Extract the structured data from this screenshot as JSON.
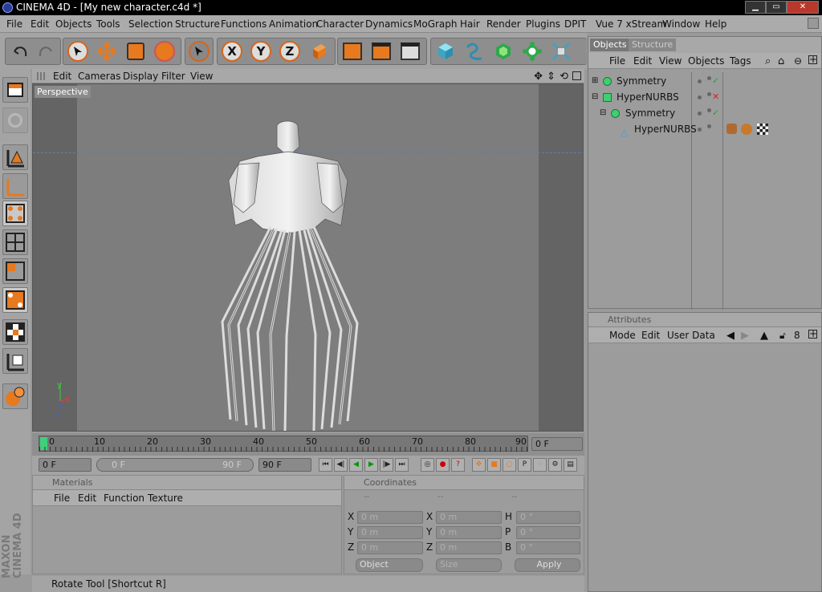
{
  "window": {
    "title": "CINEMA 4D - [My new character.c4d *]",
    "min": "▁",
    "max": "▭",
    "close": "✕"
  },
  "menu": [
    "File",
    "Edit",
    "Objects",
    "Tools",
    "Selection",
    "Structure",
    "Functions",
    "Animation",
    "Character",
    "Dynamics",
    "MoGraph",
    "Hair",
    "Render",
    "Plugins",
    "DPIT",
    "Vue 7 xStream",
    "Window",
    "Help"
  ],
  "toolbar": {
    "x_label": "X",
    "y_label": "Y",
    "z_label": "Z"
  },
  "left_tools": [
    "View",
    "Model",
    "Object",
    "Polygon",
    "Points",
    "Edges",
    "Polygons",
    "Select",
    "Texture",
    "Axis",
    "Sculpt"
  ],
  "viewport": {
    "menu": [
      "Edit",
      "Cameras",
      "Display",
      "Filter",
      "View"
    ],
    "label": "Perspective",
    "axis_x": "x",
    "axis_y": "y",
    "axis_z": "z"
  },
  "timeline": {
    "ticks": [
      "0",
      "10",
      "20",
      "30",
      "40",
      "50",
      "60",
      "70",
      "80",
      "90"
    ],
    "current_frame": "0 F"
  },
  "playback": {
    "start": "0 F",
    "range_start": "0 F",
    "range_end": "90 F",
    "end": "90 F"
  },
  "objects_panel": {
    "tabs": [
      "Objects",
      "Structure"
    ],
    "menu": [
      "File",
      "Edit",
      "View",
      "Objects",
      "Tags"
    ],
    "items": [
      {
        "name": "Symmetry"
      },
      {
        "name": "HyperNURBS"
      },
      {
        "name": "Symmetry"
      },
      {
        "name": "HyperNURBS"
      }
    ]
  },
  "attributes_panel": {
    "title": "Attributes",
    "menu": [
      "Mode",
      "Edit",
      "User Data"
    ]
  },
  "materials_panel": {
    "title": "Materials",
    "menu": [
      "File",
      "Edit",
      "Function",
      "Texture"
    ]
  },
  "coordinates_panel": {
    "title": "Coordinates",
    "col_headers": [
      "--",
      "--",
      "--"
    ],
    "rows": [
      {
        "a": "X",
        "av": "0 m",
        "b": "X",
        "bv": "0 m",
        "c": "H",
        "cv": "0 °"
      },
      {
        "a": "Y",
        "av": "0 m",
        "b": "Y",
        "bv": "0 m",
        "c": "P",
        "cv": "0 °"
      },
      {
        "a": "Z",
        "av": "0 m",
        "b": "Z",
        "bv": "0 m",
        "c": "B",
        "cv": "0 °"
      }
    ],
    "mode": "Object",
    "size": "Size",
    "apply": "Apply"
  },
  "status": {
    "text": "Rotate Tool [Shortcut R]"
  },
  "brand": {
    "text": "MAXON CINEMA 4D"
  }
}
